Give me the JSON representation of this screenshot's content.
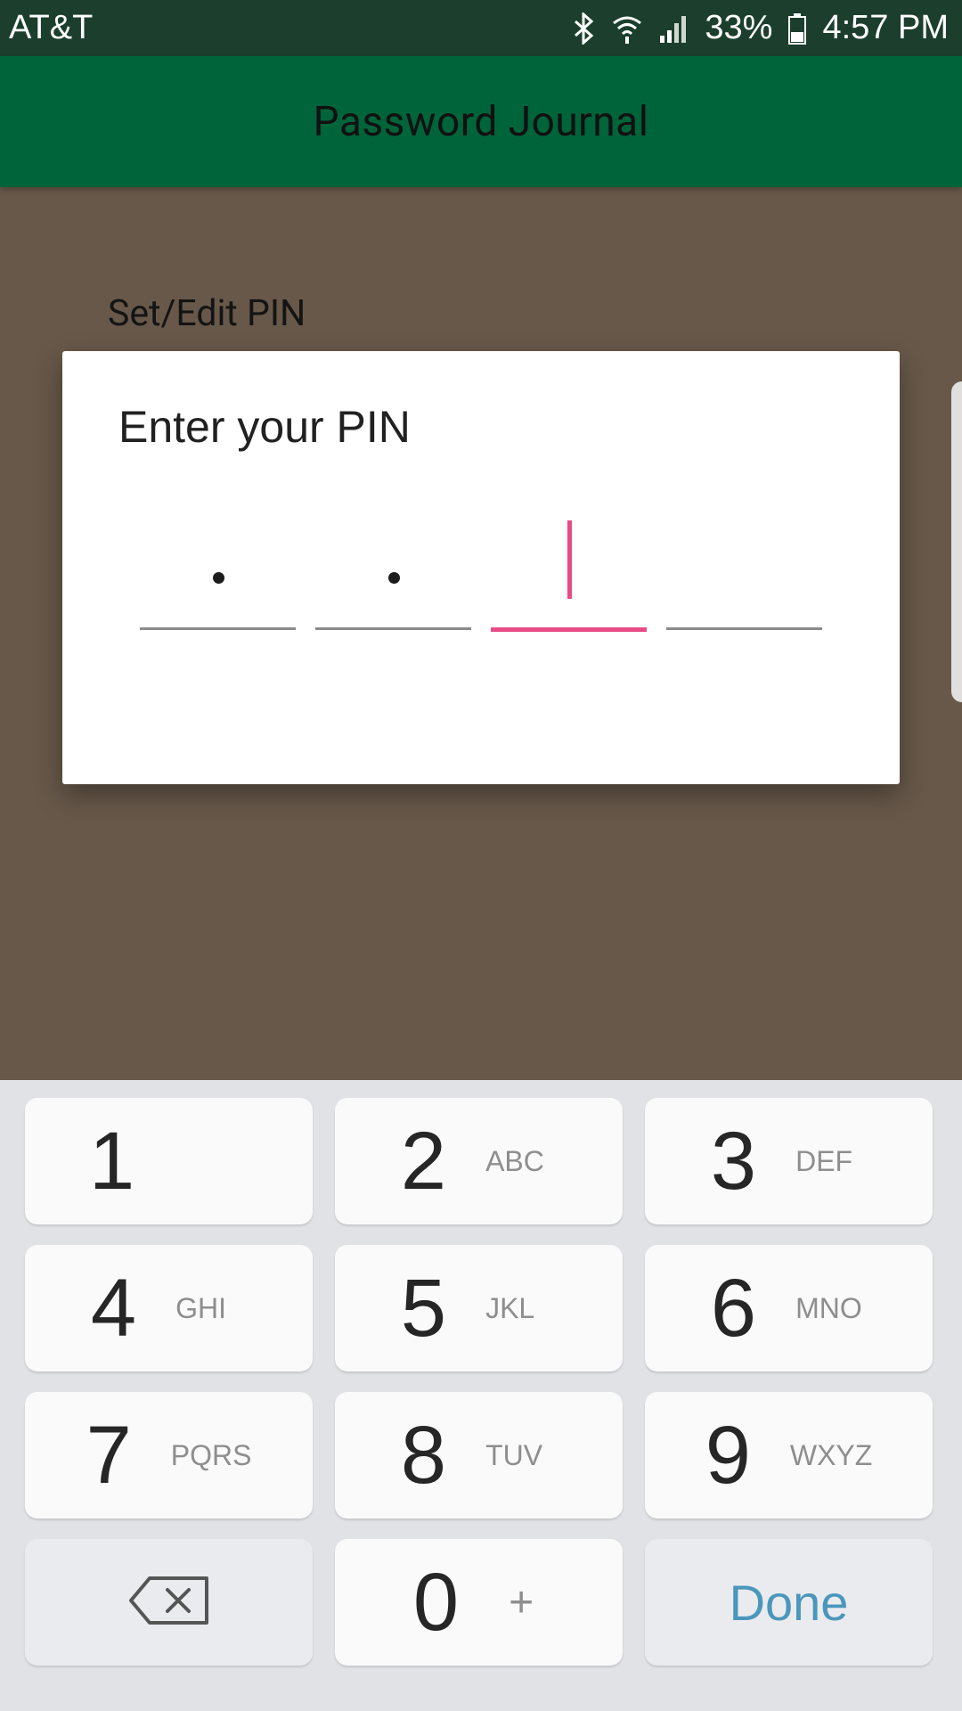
{
  "status_bar": {
    "carrier": "AT&T",
    "battery_percent": "33%",
    "time": "4:57 PM",
    "icons": [
      "bluetooth-icon",
      "wifi-icon",
      "signal-icon",
      "battery-icon"
    ]
  },
  "app_bar": {
    "title": "Password Journal"
  },
  "background": {
    "preference_label": "Set/Edit PIN"
  },
  "dialog": {
    "title": "Enter your PIN",
    "pin_fields_total": 4,
    "pin_digits_entered": 2,
    "active_field_index": 2,
    "accent_color": "#e94b86"
  },
  "keyboard": {
    "keys": [
      {
        "digit": "1",
        "letters": ""
      },
      {
        "digit": "2",
        "letters": "ABC"
      },
      {
        "digit": "3",
        "letters": "DEF"
      },
      {
        "digit": "4",
        "letters": "GHI"
      },
      {
        "digit": "5",
        "letters": "JKL"
      },
      {
        "digit": "6",
        "letters": "MNO"
      },
      {
        "digit": "7",
        "letters": "PQRS"
      },
      {
        "digit": "8",
        "letters": "TUV"
      },
      {
        "digit": "9",
        "letters": "WXYZ"
      },
      {
        "digit": "0",
        "letters": "+"
      }
    ],
    "backspace_icon": "backspace-icon",
    "done_label": "Done"
  },
  "colors": {
    "status_bar": "#1b3f2c",
    "app_bar": "#00643a",
    "scrim": "#675849",
    "done_text": "#4b97bc"
  }
}
